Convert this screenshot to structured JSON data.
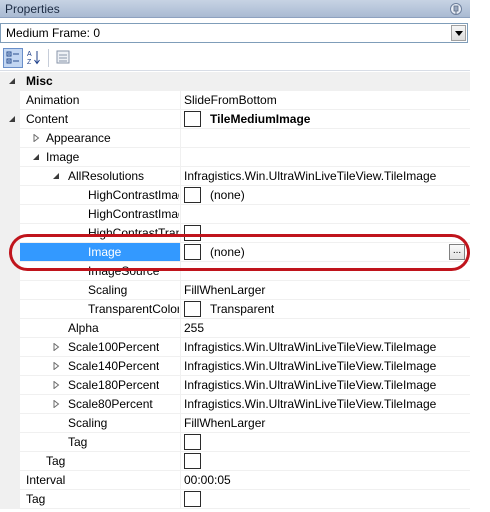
{
  "window": {
    "title": "Properties"
  },
  "selector": {
    "value": "Medium Frame: 0"
  },
  "toolbar": {
    "buttons": [
      {
        "icon": "categorized-icon",
        "active": true
      },
      {
        "icon": "alphabetical-icon",
        "active": false
      },
      {
        "icon": "property-pages-icon",
        "active": false
      }
    ]
  },
  "grid": {
    "rows": [
      {
        "name": "Misc",
        "value": "",
        "kind": "category",
        "expander": "expanded"
      },
      {
        "name": "Animation",
        "value": "SlideFromBottom"
      },
      {
        "name": "Content",
        "value": "TileMediumImage",
        "value_bold": true,
        "swatch": true,
        "expander": "expanded"
      },
      {
        "name": "Appearance",
        "value": "",
        "expander": "collapsed"
      },
      {
        "name": "Image",
        "value": "",
        "expander": "expanded"
      },
      {
        "name": "AllResolutions",
        "value": "Infragistics.Win.UltraWinLiveTileView.TileImage",
        "expander": "expanded"
      },
      {
        "name": "HighContrastImage",
        "value": "(none)",
        "swatch": true
      },
      {
        "name": "HighContrastImageSource",
        "value": ""
      },
      {
        "name": "HighContrastTransparentColor",
        "value": "",
        "swatch": true
      },
      {
        "name": "Image",
        "value": "(none)",
        "swatch": true,
        "selected": true,
        "ellipsis": "..."
      },
      {
        "name": "ImageSource",
        "value": ""
      },
      {
        "name": "Scaling",
        "value": "FillWhenLarger"
      },
      {
        "name": "TransparentColor",
        "value": "Transparent",
        "swatch": true
      },
      {
        "name": "Alpha",
        "value": "255"
      },
      {
        "name": "Scale100Percent",
        "value": "Infragistics.Win.UltraWinLiveTileView.TileImage",
        "expander": "collapsed"
      },
      {
        "name": "Scale140Percent",
        "value": "Infragistics.Win.UltraWinLiveTileView.TileImage",
        "expander": "collapsed"
      },
      {
        "name": "Scale180Percent",
        "value": "Infragistics.Win.UltraWinLiveTileView.TileImage",
        "expander": "collapsed"
      },
      {
        "name": "Scale80Percent",
        "value": "Infragistics.Win.UltraWinLiveTileView.TileImage",
        "expander": "collapsed"
      },
      {
        "name": "Scaling",
        "value": "FillWhenLarger"
      },
      {
        "name": "Tag",
        "value": "",
        "swatch": true
      },
      {
        "name": "Tag",
        "value": "",
        "swatch": true
      },
      {
        "name": "Interval",
        "value": "00:00:05"
      },
      {
        "name": "Tag",
        "value": "",
        "swatch": true
      }
    ]
  },
  "colors": {
    "selection": "#3399ff",
    "highlight_ring": "#c0141c",
    "gutter": "#f0f0f0"
  }
}
